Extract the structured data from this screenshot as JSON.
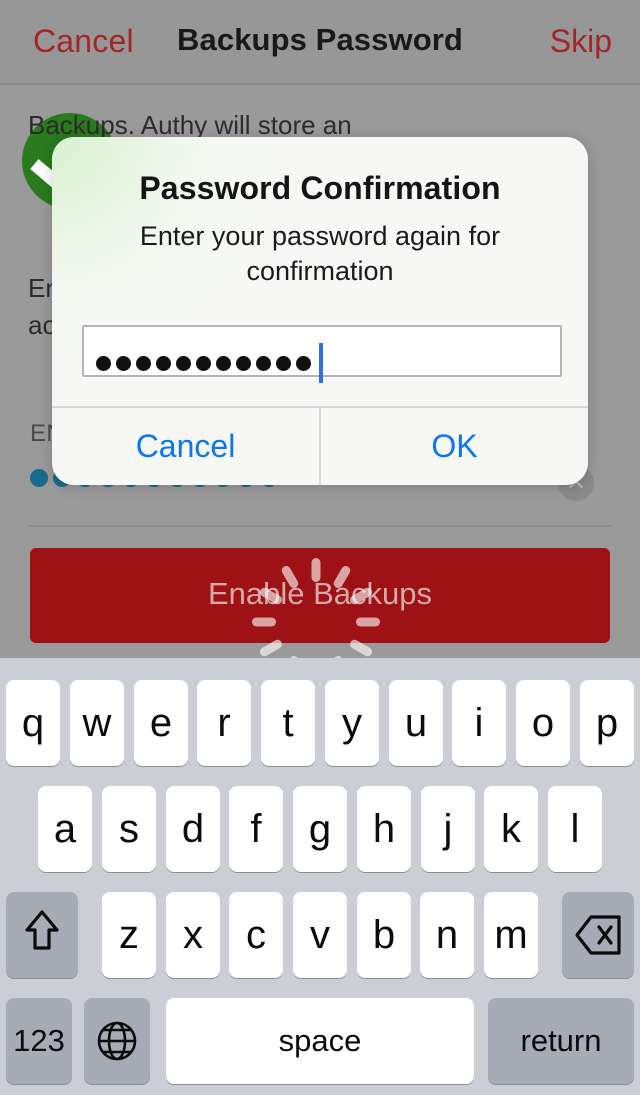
{
  "navbar": {
    "cancel_label": "Cancel",
    "title": "Backups Password",
    "skip_label": "Skip",
    "accent_color": "#a32525"
  },
  "background": {
    "check_icon": "check-circle-icon",
    "paragraph_1": "Backups. Authy will store an",
    "paragraph_2": "Enter a password so that Authy can encrypt your accounts.",
    "field_label": "EN",
    "password_dots": 11,
    "clear_icon": "clear-circle-icon",
    "enable_button_label": "Enable Backups",
    "enable_button_color": "#9e1114",
    "loading_icon": "spinner-icon",
    "is_loading": true
  },
  "alert": {
    "title": "Password Confirmation",
    "message": "Enter your password again for confirmation",
    "input": {
      "value_dots": 11,
      "placeholder": "",
      "focused": true
    },
    "cancel_label": "Cancel",
    "ok_label": "OK",
    "button_color": "#0b76ef"
  },
  "keyboard": {
    "row1": [
      "q",
      "w",
      "e",
      "r",
      "t",
      "y",
      "u",
      "i",
      "o",
      "p"
    ],
    "row2": [
      "a",
      "s",
      "d",
      "f",
      "g",
      "h",
      "j",
      "k",
      "l"
    ],
    "row3": [
      "z",
      "x",
      "c",
      "v",
      "b",
      "n",
      "m"
    ],
    "shift_icon": "shift-icon",
    "backspace_icon": "backspace-icon",
    "numbers_label": "123",
    "globe_icon": "globe-icon",
    "space_label": "space",
    "return_label": "return"
  }
}
